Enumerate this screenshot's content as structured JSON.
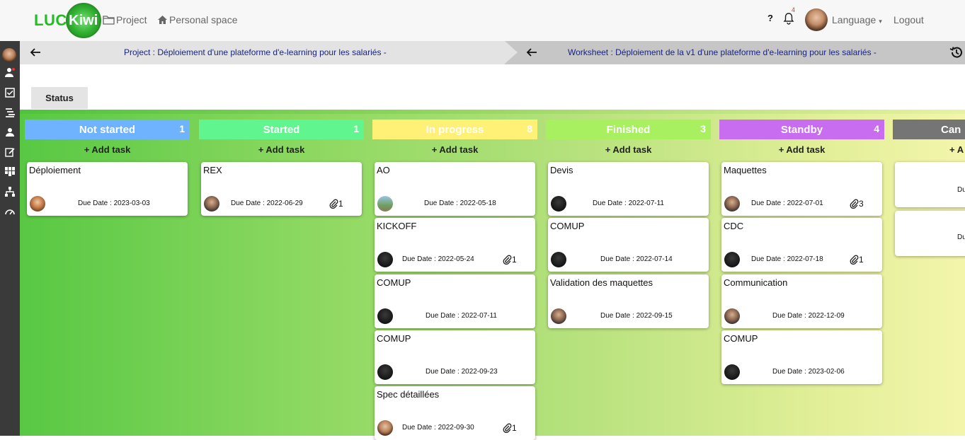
{
  "header": {
    "logo_left": "LUC",
    "logo_right": "Kiwi",
    "nav_project": "Project",
    "nav_personal": "Personal space",
    "help": "?",
    "notifications_count": "4",
    "language": "Language",
    "logout": "Logout"
  },
  "breadcrumb": {
    "project": "Project : Déploiement d'une plateforme d'e-learning pour les salariés -",
    "worksheet": "Worksheet : Déploiement de la v1 d'une plateforme d'e-learning pour les salariés -"
  },
  "tabs": {
    "status": "Status"
  },
  "columns": [
    {
      "title": "Not started",
      "count": "1",
      "color": "#6fb3ff",
      "add": "+ Add task",
      "cards": [
        {
          "title": "Déploiement",
          "due": "Due Date : 2023-03-03",
          "attachments": ""
        }
      ]
    },
    {
      "title": "Started",
      "count": "1",
      "color": "#61f58f",
      "add": "+ Add task",
      "cards": [
        {
          "title": "REX",
          "due": "Due Date : 2022-06-29",
          "attachments": "1"
        }
      ]
    },
    {
      "title": "In progress",
      "count": "8",
      "color": "#fff176",
      "add": "+ Add task",
      "cards": [
        {
          "title": "AO",
          "due": "Due Date : 2022-05-18",
          "attachments": ""
        },
        {
          "title": "KICKOFF",
          "due": "Due Date : 2022-05-24",
          "attachments": "1"
        },
        {
          "title": "COMUP",
          "due": "Due Date : 2022-07-11",
          "attachments": ""
        },
        {
          "title": "COMUP",
          "due": "Due Date : 2022-09-23",
          "attachments": ""
        },
        {
          "title": "Spec détaillées",
          "due": "Due Date : 2022-09-30",
          "attachments": "1"
        }
      ]
    },
    {
      "title": "Finished",
      "count": "3",
      "color": "#a8f060",
      "add": "+ Add task",
      "cards": [
        {
          "title": "Devis",
          "due": "Due Date : 2022-07-11",
          "attachments": ""
        },
        {
          "title": "COMUP",
          "due": "Due Date : 2022-07-14",
          "attachments": ""
        },
        {
          "title": "Validation des maquettes",
          "due": "Due Date : 2022-09-15",
          "attachments": ""
        }
      ]
    },
    {
      "title": "Standby",
      "count": "4",
      "color": "#c86cf0",
      "add": "+ Add task",
      "cards": [
        {
          "title": "Maquettes",
          "due": "Due Date : 2022-07-01",
          "attachments": "3"
        },
        {
          "title": "CDC",
          "due": "Due Date : 2022-07-18",
          "attachments": "1"
        },
        {
          "title": "Communication",
          "due": "Due Date : 2022-12-09",
          "attachments": ""
        },
        {
          "title": "COMUP",
          "due": "Due Date : 2023-02-06",
          "attachments": ""
        }
      ]
    },
    {
      "title": "Can",
      "count": "",
      "color": "#757575",
      "add": "+ A",
      "cards": [
        {
          "title": "",
          "due": "Du",
          "attachments": ""
        },
        {
          "title": "",
          "due": "Du",
          "attachments": ""
        }
      ]
    }
  ]
}
